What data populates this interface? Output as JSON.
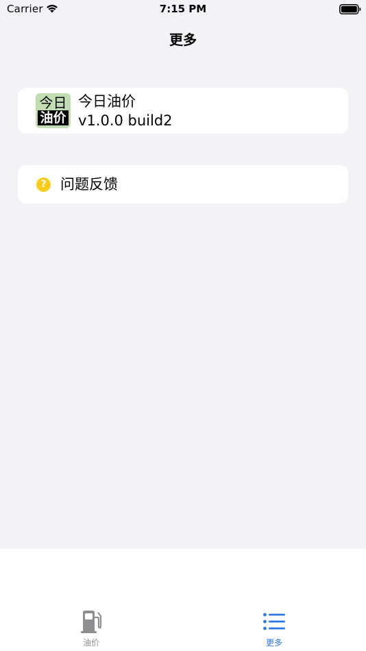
{
  "status_bar": {
    "carrier": "Carrier",
    "time": "7:15 PM"
  },
  "nav": {
    "title": "更多"
  },
  "app_card": {
    "icon_top_text": "今日",
    "icon_bottom_text": "油价",
    "name": "今日油价",
    "version": "v1.0.0 build2"
  },
  "feedback": {
    "icon_glyph": "?",
    "label": "问题反馈"
  },
  "tabs": [
    {
      "label": "油价",
      "icon": "gas-pump-icon",
      "selected": false
    },
    {
      "label": "更多",
      "icon": "list-icon",
      "selected": true
    }
  ],
  "colors": {
    "background": "#f2f2f7",
    "accent": "#2979e6",
    "help_icon": "#fccc1d",
    "inactive_tab": "#8e8e93"
  }
}
